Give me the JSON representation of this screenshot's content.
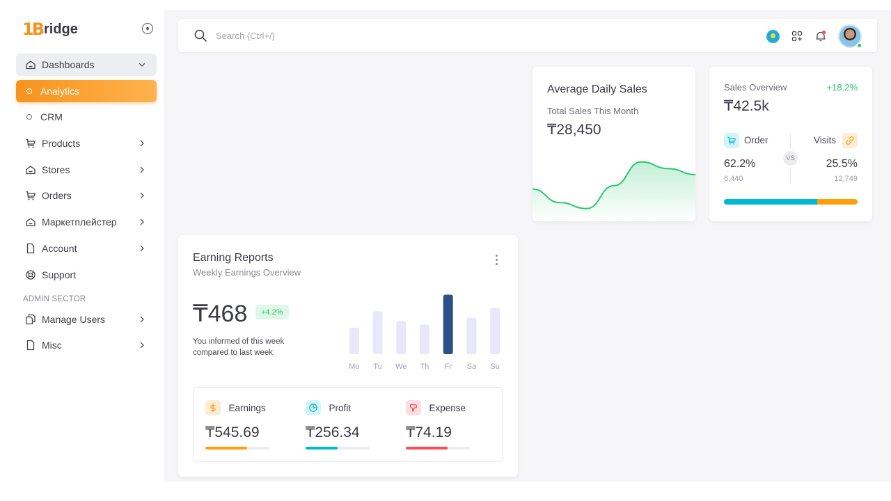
{
  "sidebar": {
    "logo_mark": "1B",
    "logo_text": "ridge",
    "items": [
      {
        "label": "Dashboards",
        "icon": "home-icon"
      },
      {
        "label": "Analytics"
      },
      {
        "label": "CRM"
      },
      {
        "label": "Products",
        "icon": "cart-icon"
      },
      {
        "label": "Stores",
        "icon": "home-icon"
      },
      {
        "label": "Orders",
        "icon": "cart-icon"
      },
      {
        "label": "Маркетплейстер",
        "icon": "home-icon"
      },
      {
        "label": "Account",
        "icon": "file-icon"
      },
      {
        "label": "Support",
        "icon": "lifebuoy-icon"
      }
    ],
    "section_title": "ADMIN SECTOR",
    "admin_items": [
      {
        "label": "Manage Users",
        "icon": "copy-icon"
      },
      {
        "label": "Misc",
        "icon": "file-icon"
      }
    ]
  },
  "topbar": {
    "search_placeholder": "Search (Ctrl+/)"
  },
  "colors": {
    "accent": "#f7931e",
    "success": "#28c76f",
    "info": "#00bad1",
    "warning": "#ff9f0a",
    "danger": "#ff4c51",
    "bar_muted": "#e8e7fb",
    "bar_active": "#2d5087"
  },
  "avg_daily_sales": {
    "title": "Average Daily Sales",
    "subtitle": "Total Sales This Month",
    "value": "₸28,450"
  },
  "sales_overview": {
    "title": "Sales Overview",
    "growth": "+18.2%",
    "value": "₸42.5k",
    "order_label": "Order",
    "order_pct": "62.2%",
    "order_count": "6,440",
    "vs_label": "VS",
    "visits_label": "Visits",
    "visits_pct": "25.5%",
    "visits_count": "12,749",
    "order_share": 0.7
  },
  "earning_reports": {
    "title": "Earning Reports",
    "subtitle": "Weekly Earnings Overview",
    "value": "₸468",
    "badge": "+4.2%",
    "note": "You informed of this week compared to last week",
    "stats": [
      {
        "label": "Earnings",
        "value": "₸545.69",
        "progress": 0.65,
        "icon": "dollar-icon"
      },
      {
        "label": "Profit",
        "value": "₸256.34",
        "progress": 0.5,
        "icon": "pie-chart-icon"
      },
      {
        "label": "Expense",
        "value": "₸74.19",
        "progress": 0.65,
        "icon": "paint-icon"
      }
    ]
  },
  "chart_data": [
    {
      "type": "bar",
      "title": "",
      "categories": [
        "Mo",
        "Tu",
        "We",
        "Th",
        "Fr",
        "Sa",
        "Su"
      ],
      "values": [
        40,
        65,
        50,
        45,
        90,
        55,
        70
      ],
      "highlight_index": 4,
      "ylim": [
        0,
        100
      ],
      "grid": false
    },
    {
      "type": "area",
      "title": "",
      "x": [
        0,
        1,
        2,
        3,
        4,
        5,
        6
      ],
      "values": [
        38,
        22,
        15,
        42,
        70,
        62,
        55
      ],
      "ylim": [
        0,
        100
      ],
      "grid": false
    }
  ]
}
